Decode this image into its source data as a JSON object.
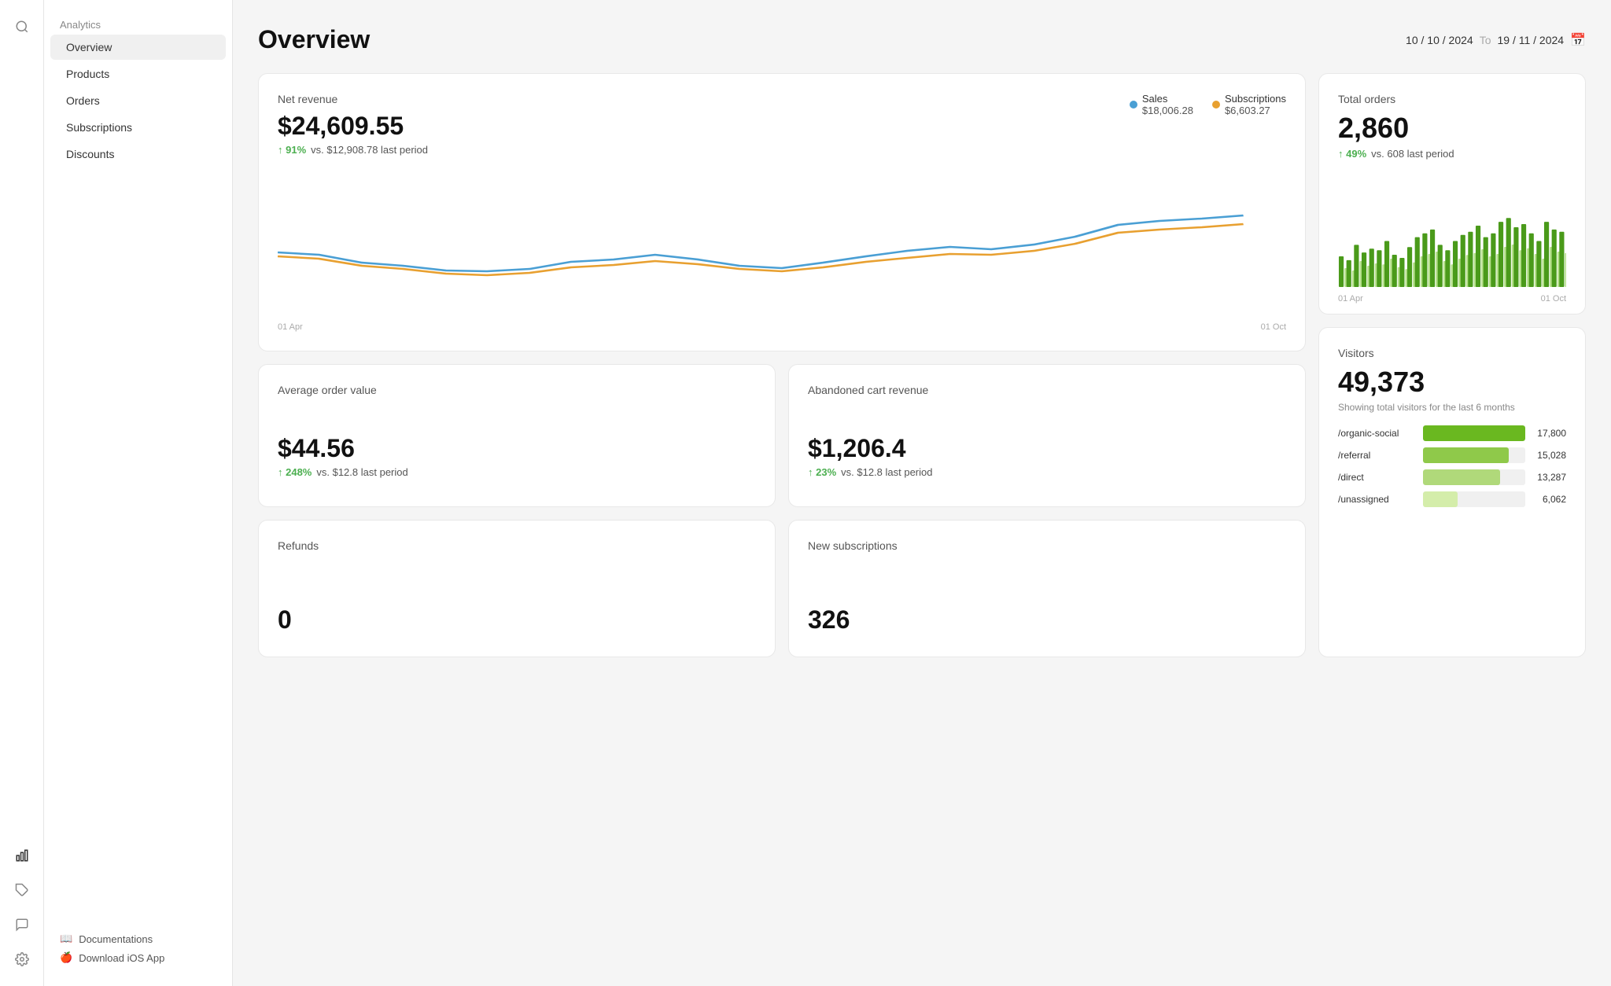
{
  "app": {
    "title": "Analytics"
  },
  "sidebar_icons": [
    {
      "name": "search-icon",
      "symbol": "🔍"
    },
    {
      "name": "analytics-icon",
      "symbol": "📊"
    },
    {
      "name": "tag-icon",
      "symbol": "🏷"
    },
    {
      "name": "chat-icon",
      "symbol": "💬"
    },
    {
      "name": "settings-icon",
      "symbol": "⚙"
    }
  ],
  "nav": {
    "section": "Analytics",
    "items": [
      {
        "label": "Overview",
        "active": true
      },
      {
        "label": "Products",
        "active": false
      },
      {
        "label": "Orders",
        "active": false
      },
      {
        "label": "Subscriptions",
        "active": false
      },
      {
        "label": "Discounts",
        "active": false
      }
    ],
    "footer": [
      {
        "label": "Documentations",
        "icon": "📖"
      },
      {
        "label": "Download iOS App",
        "icon": "🍎"
      }
    ]
  },
  "header": {
    "title": "Overview",
    "date_from": "10 / 10 / 2024",
    "date_to_label": "To",
    "date_to": "19 / 11 / 2024"
  },
  "net_revenue": {
    "title": "Net revenue",
    "value": "$24,609.55",
    "delta_pct": "↑ 91%",
    "delta_text": "vs. $12,908.78 last period",
    "legend_sales_label": "Sales",
    "legend_sales_value": "$18,006.28",
    "legend_subs_label": "Subscriptions",
    "legend_subs_value": "$6,603.27",
    "date_start": "01 Apr",
    "date_end": "01 Oct",
    "chart_sales": [
      55,
      52,
      44,
      42,
      38,
      38,
      40,
      46,
      48,
      52,
      48,
      42,
      40,
      44,
      50,
      54,
      60,
      58,
      62,
      70,
      80,
      85,
      88,
      90
    ],
    "chart_subs": [
      50,
      48,
      40,
      38,
      35,
      34,
      36,
      40,
      42,
      46,
      44,
      38,
      36,
      40,
      44,
      48,
      52,
      55,
      58,
      62,
      68,
      72,
      76,
      80
    ]
  },
  "total_orders": {
    "title": "Total orders",
    "value": "2,860",
    "delta_pct": "↑ 49%",
    "delta_text": "vs. 608 last period",
    "date_start": "01 Apr",
    "date_end": "01 Oct"
  },
  "avg_order_value": {
    "title": "Average order value",
    "value": "$44.56",
    "delta_pct": "↑ 248%",
    "delta_text": "vs. $12.8 last period"
  },
  "abandoned_cart": {
    "title": "Abandoned cart revenue",
    "value": "$1,206.4",
    "delta_pct": "↑ 23%",
    "delta_text": "vs. $12.8 last period"
  },
  "refunds": {
    "title": "Refunds",
    "value": "0"
  },
  "new_subscriptions": {
    "title": "New subscriptions",
    "value": "326"
  },
  "visitors": {
    "title": "Visitors",
    "value": "49,373",
    "subtitle": "Showing total visitors for the last 6 months",
    "traffic": [
      {
        "label": "/organic-social",
        "count": "17,800",
        "pct": 100
      },
      {
        "label": "/referral",
        "count": "15,028",
        "pct": 84
      },
      {
        "label": "/direct",
        "count": "13,287",
        "pct": 75
      },
      {
        "label": "/unassigned",
        "count": "6,062",
        "pct": 34
      }
    ]
  },
  "colors": {
    "green_primary": "#6dbf3d",
    "green_light": "#b5e08a",
    "blue_line": "#4a9fd4",
    "orange_line": "#e8a030",
    "accent_green": "#7bc043"
  }
}
